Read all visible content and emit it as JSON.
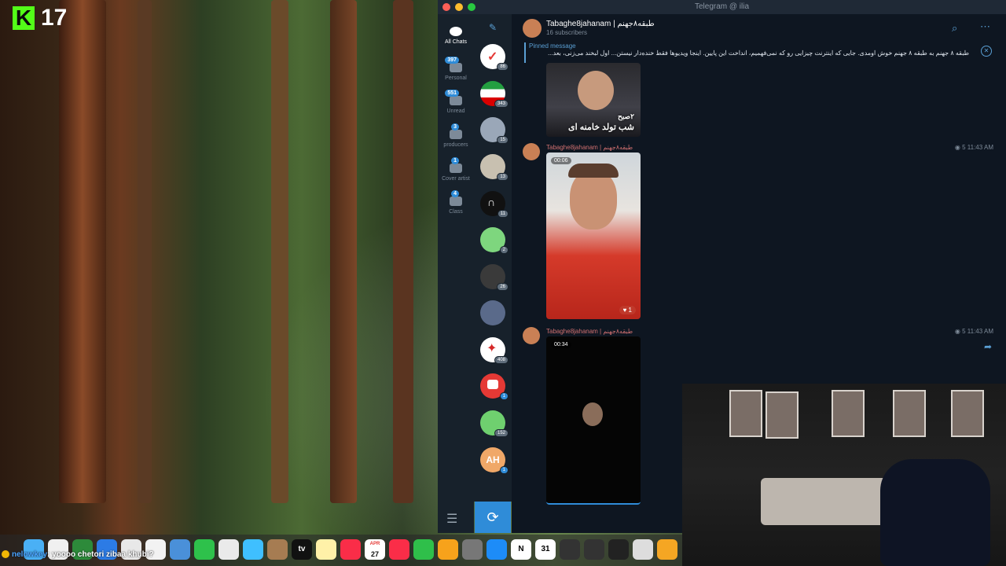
{
  "window": {
    "title": "Telegram @ ilia"
  },
  "stream": {
    "viewer_count": "17"
  },
  "folders": [
    {
      "label": "All Chats",
      "badge": ""
    },
    {
      "label": "Personal",
      "badge": "397"
    },
    {
      "label": "Unread",
      "badge": "551"
    },
    {
      "label": "producers",
      "badge": "3"
    },
    {
      "label": "Cover artist",
      "badge": "1"
    },
    {
      "label": "Class",
      "badge": "4"
    }
  ],
  "chat_list_counts": [
    "86",
    "343",
    "15",
    "13",
    "11",
    "2",
    "26",
    "",
    "408",
    "1",
    "152",
    "1"
  ],
  "chat_list_avatar_text": {
    "ah": "AH"
  },
  "channel": {
    "name": "Tabaghe8jahanam | طبقه۸جهنم",
    "subscribers": "16 subscribers"
  },
  "pinned": {
    "label": "Pinned message",
    "text": "طبقه ۸ جهنم به طبقه ۸ جهنم خوش اومدی. جایی که اینترنت چیزایی رو که نمی‌فهمیم، انداخت این پایین. اینجا ویدیوها فقط خنده‌دار نیستن... اول لبخند می‌زنی، بعد..."
  },
  "messages": [
    {
      "overlay_text_1": "۲صبح",
      "overlay_text_2": "شب تولد خامنه ای"
    },
    {
      "author": "Tabaghe8jahanam | طبقه۸جهنم",
      "views": "5",
      "time": "11:43 AM",
      "duration": "00:06",
      "reaction_count": "1"
    },
    {
      "author": "Tabaghe8jahanam | طبقه۸جهنم",
      "views": "5",
      "time": "11:43 AM",
      "duration": "00:34"
    }
  ],
  "dock": {
    "calendar_month": "APR",
    "calendar_day": "27",
    "notion": "N",
    "cal2": "31",
    "appletv": "tv"
  },
  "chat_overlay": {
    "user": "nelowkey",
    "message": ": yoooo chetori zibaa khubi?"
  },
  "colors": {
    "accent": "#2f8cd8",
    "telegram_bg": "#0e1621",
    "panel": "#17212b",
    "author_name": "#d07070"
  }
}
